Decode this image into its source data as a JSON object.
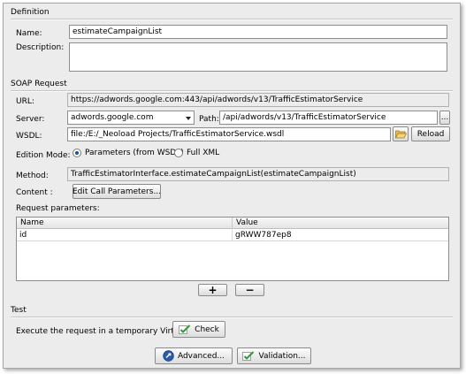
{
  "definition": {
    "section_title": "Definition",
    "name_label": "Name:",
    "name_value": "estimateCampaignList",
    "description_label": "Description:",
    "description_value": ""
  },
  "soap": {
    "section_title": "SOAP Request",
    "url_label": "URL:",
    "url_value": "https://adwords.google.com:443/api/adwords/v13/TrafficEstimatorService",
    "server_label": "Server:",
    "server_value": "adwords.google.com",
    "path_label": "Path:",
    "path_value": "/api/adwords/v13/TrafficEstimatorService",
    "path_browse_label": "...",
    "wsdl_label": "WSDL:",
    "wsdl_value": "file:/E:/_Neoload Projects/TrafficEstimatorService.wsdl",
    "reload_label": "Reload",
    "edition_mode_label": "Edition Mode:",
    "mode_parameters_label": "Parameters (from WSDL)",
    "mode_full_xml_label": "Full XML",
    "selected_mode": "Parameters (from WSDL)",
    "method_label": "Method:",
    "method_value": "TrafficEstimatorInterface.estimateCampaignList(estimateCampaignList)",
    "content_label": "Content :",
    "edit_call_label": "Edit Call Parameters...",
    "request_params_label": "Request parameters:",
    "table": {
      "columns": [
        "Name",
        "Value"
      ],
      "rows": [
        {
          "name": "id",
          "value": "gRWW787ep8"
        }
      ]
    },
    "add_label": "+",
    "remove_label": "−"
  },
  "test": {
    "section_title": "Test",
    "execute_label": "Execute the request in a temporary Virtual User",
    "check_label": "Check"
  },
  "footer": {
    "advanced_label": "Advanced...",
    "validation_label": "Validation..."
  },
  "colors": {
    "window_bg": "#ececec",
    "accent_blue": "#1d4f9a",
    "check_green": "#2f9a2f"
  }
}
